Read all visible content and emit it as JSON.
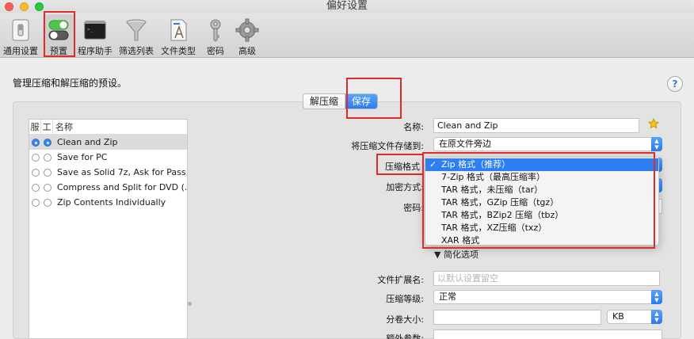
{
  "window": {
    "title": "偏好设置"
  },
  "toolbar": {
    "items": [
      {
        "label": "通用设置",
        "icon": "general-switch-icon"
      },
      {
        "label": "预置",
        "icon": "presets-toggle-icon"
      },
      {
        "label": "程序助手",
        "icon": "terminal-icon"
      },
      {
        "label": "筛选列表",
        "icon": "funnel-icon"
      },
      {
        "label": "文件类型",
        "icon": "document-icon"
      },
      {
        "label": "密码",
        "icon": "key-icon"
      },
      {
        "label": "高级",
        "icon": "gear-icon"
      }
    ]
  },
  "intro": "管理压缩和解压缩的预设。",
  "help": "?",
  "segment": {
    "left": "解压缩",
    "right": "保存"
  },
  "list": {
    "headers": [
      "服",
      "工",
      "名称"
    ],
    "rows": [
      {
        "label": "Clean and Zip",
        "selected": true
      },
      {
        "label": "Save for PC",
        "selected": false
      },
      {
        "label": "Save as Solid 7z, Ask for Pass...",
        "selected": false
      },
      {
        "label": "Compress and Split for DVD (...",
        "selected": false
      },
      {
        "label": "Zip Contents Individually",
        "selected": false
      }
    ]
  },
  "form": {
    "name_label": "名称:",
    "name_value": "Clean and Zip",
    "save_to_label": "将压缩文件存储到:",
    "save_to_value": "在原文件旁边",
    "format_label": "压缩格式",
    "encryption_label": "加密方式:",
    "password_label": "密码:",
    "options_toggle": "▼ 简化选项",
    "extension_label": "文件扩展名:",
    "extension_placeholder": "以默认设置留空",
    "level_label": "压缩等级:",
    "level_value": "正常",
    "split_label": "分卷大小:",
    "split_unit": "KB",
    "extra_label": "额外参数:"
  },
  "format_menu": {
    "items": [
      {
        "label": "Zip 格式（推荐）",
        "checked": true
      },
      {
        "label": "7-Zip 格式（最高压缩率）",
        "checked": false
      },
      {
        "label": "TAR 格式，未压缩（tar）",
        "checked": false
      },
      {
        "label": "TAR 格式，GZip 压缩（tgz）",
        "checked": false
      },
      {
        "label": "TAR 格式，BZip2 压缩（tbz）",
        "checked": false
      },
      {
        "label": "TAR 格式，XZ压缩（txz）",
        "checked": false
      },
      {
        "label": "XAR 格式",
        "checked": false
      }
    ],
    "check_mark": "✓"
  },
  "colors": {
    "accent": "#2e7ff3",
    "highlight_box": "#e02b2b"
  }
}
